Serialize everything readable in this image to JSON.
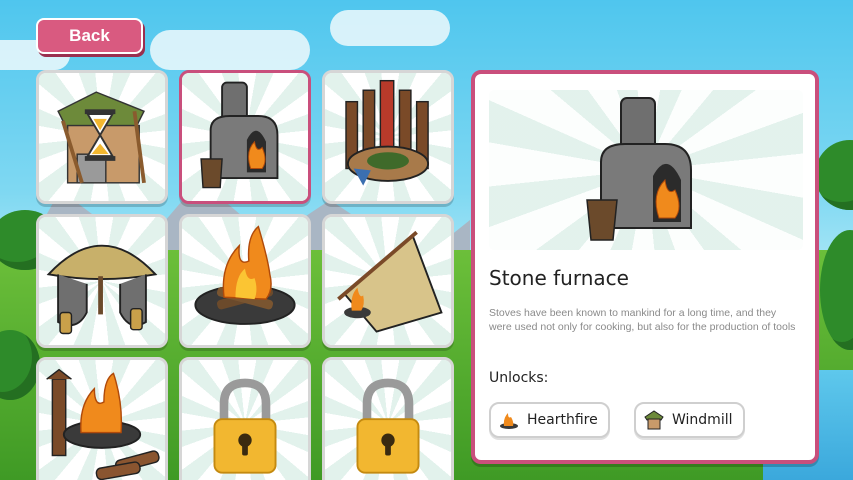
{
  "back_label": "Back",
  "grid": {
    "items": [
      {
        "name": "windmill",
        "state": "in-progress"
      },
      {
        "name": "stone-furnace",
        "state": "selected"
      },
      {
        "name": "wooden-shrine",
        "state": "available"
      },
      {
        "name": "thatched-hut",
        "state": "available"
      },
      {
        "name": "campfire",
        "state": "available"
      },
      {
        "name": "lean-to-shelter",
        "state": "available"
      },
      {
        "name": "totem-fire",
        "state": "available"
      },
      {
        "name": "locked",
        "state": "locked"
      },
      {
        "name": "locked",
        "state": "locked"
      }
    ]
  },
  "details": {
    "title": "Stone furnace",
    "description": "Stoves have been known to mankind for a long time, and they were used not only for cooking, but also for the production of tools",
    "unlocks_label": "Unlocks:",
    "unlocks": [
      {
        "label": "Hearthfire",
        "icon": "campfire-icon"
      },
      {
        "label": "Windmill",
        "icon": "windmill-icon"
      }
    ]
  },
  "colors": {
    "accent": "#c94f7c",
    "button": "#d95a80",
    "lock": "#f2b730"
  }
}
